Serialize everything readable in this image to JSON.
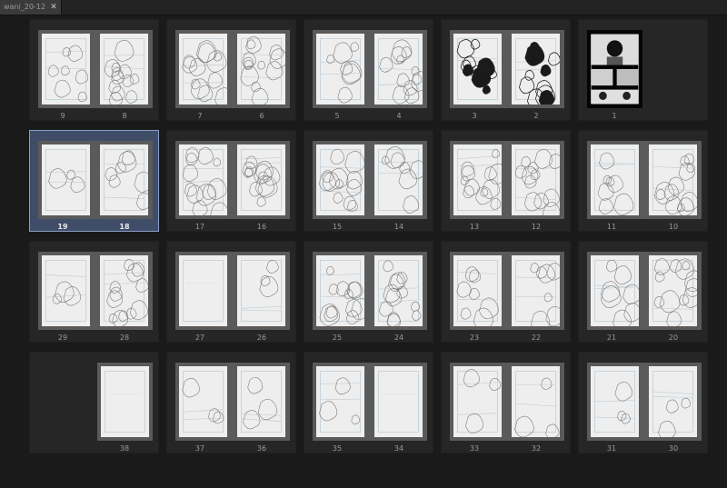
{
  "tab": {
    "title": "wani_20-12",
    "close_label": "✕"
  },
  "rows": [
    {
      "cells": [
        {
          "left": "9",
          "right": "8",
          "sketch_left": "medium",
          "sketch_right": "heavy"
        },
        {
          "left": "7",
          "right": "6",
          "sketch_left": "heavy",
          "sketch_right": "heavy"
        },
        {
          "left": "5",
          "right": "4",
          "sketch_left": "medium",
          "sketch_right": "heavy"
        },
        {
          "left": "3",
          "right": "2",
          "sketch_left": "inked",
          "sketch_right": "inked"
        },
        {
          "single": "1",
          "cover": true
        }
      ]
    },
    {
      "cells": [
        {
          "left": "19",
          "right": "18",
          "sketch_left": "light",
          "sketch_right": "medium",
          "selected": true
        },
        {
          "left": "17",
          "right": "16",
          "sketch_left": "heavy",
          "sketch_right": "heavy"
        },
        {
          "left": "15",
          "right": "14",
          "sketch_left": "heavy",
          "sketch_right": "medium"
        },
        {
          "left": "13",
          "right": "12",
          "sketch_left": "heavy",
          "sketch_right": "heavy"
        },
        {
          "left": "11",
          "right": "10",
          "sketch_left": "medium",
          "sketch_right": "heavy"
        }
      ]
    },
    {
      "cells": [
        {
          "left": "29",
          "right": "28",
          "sketch_left": "light",
          "sketch_right": "heavy"
        },
        {
          "left": "27",
          "right": "26",
          "sketch_left": "empty",
          "sketch_right": "light"
        },
        {
          "left": "25",
          "right": "24",
          "sketch_left": "heavy",
          "sketch_right": "heavy"
        },
        {
          "left": "23",
          "right": "22",
          "sketch_left": "medium",
          "sketch_right": "medium"
        },
        {
          "left": "21",
          "right": "20",
          "sketch_left": "medium",
          "sketch_right": "heavy"
        }
      ]
    },
    {
      "cells": [
        {
          "right_only": "38",
          "sketch_right": "empty"
        },
        {
          "left": "37",
          "right": "36",
          "sketch_left": "light",
          "sketch_right": "light"
        },
        {
          "left": "35",
          "right": "34",
          "sketch_left": "light",
          "sketch_right": "empty"
        },
        {
          "left": "33",
          "right": "32",
          "sketch_left": "light",
          "sketch_right": "light"
        },
        {
          "left": "31",
          "right": "30",
          "sketch_left": "light",
          "sketch_right": "light"
        }
      ]
    }
  ],
  "colors": {
    "background": "#1a1a1a",
    "cell": "#262626",
    "selected": "#3f4d68",
    "page": "#eeeeee"
  }
}
